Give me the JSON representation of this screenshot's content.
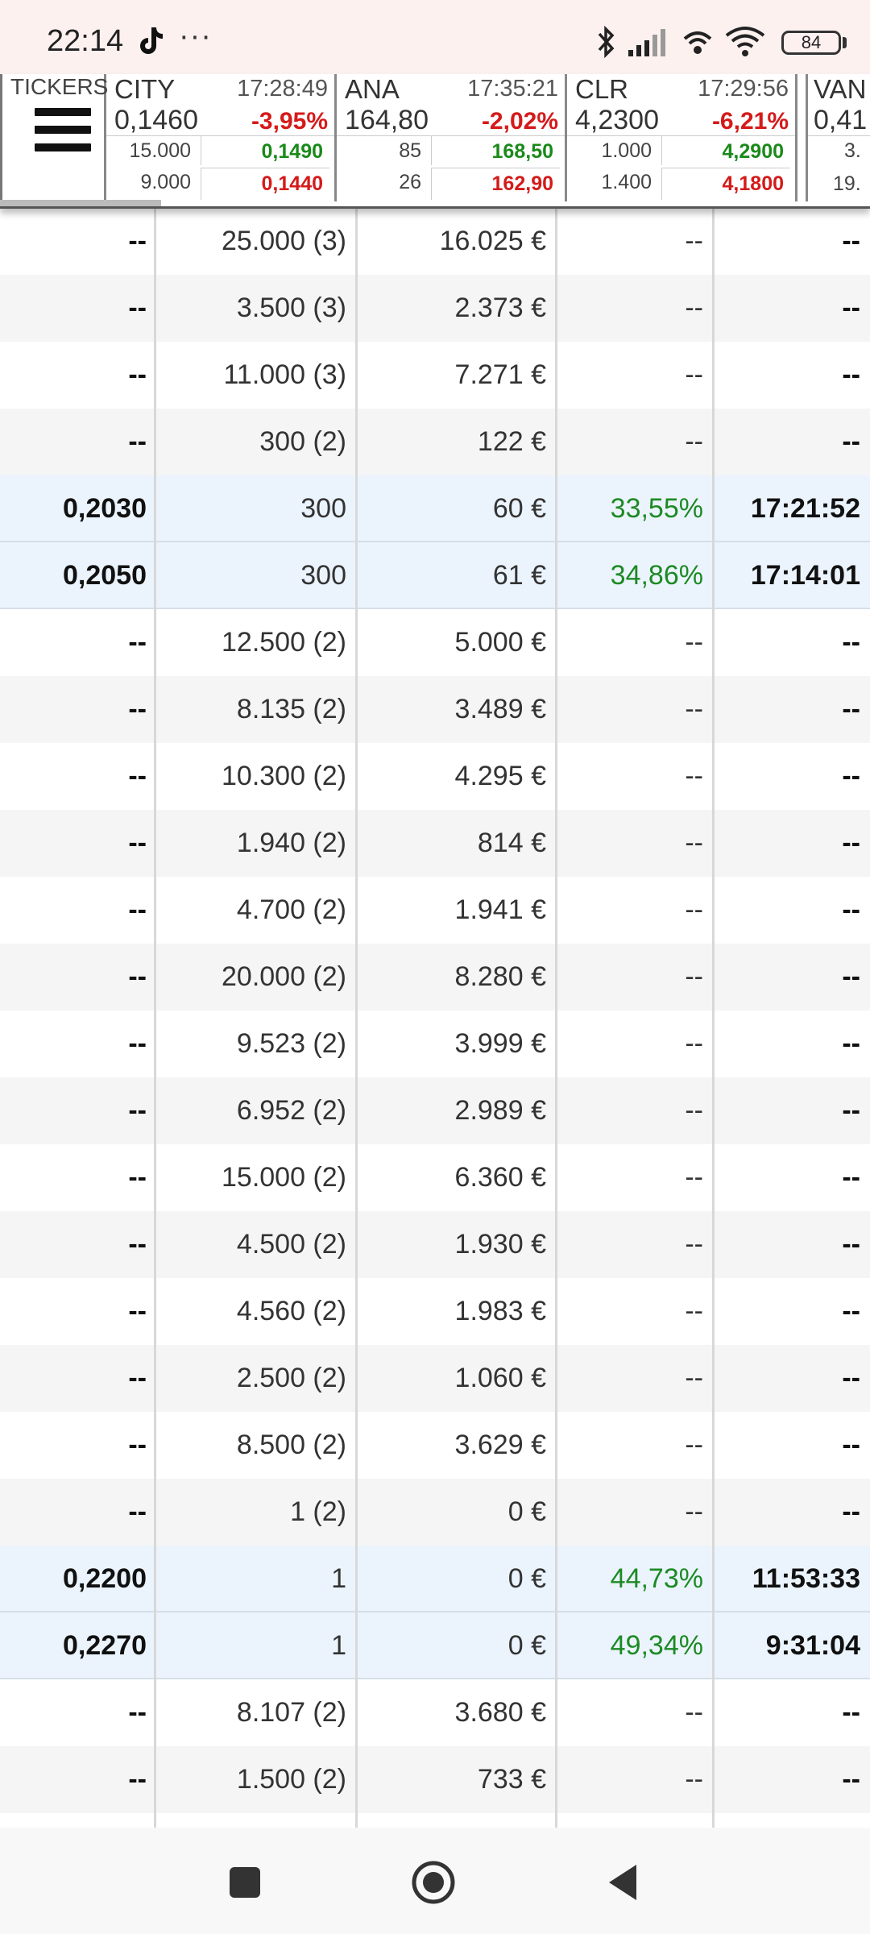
{
  "status_bar": {
    "time": "22:14",
    "more": "···",
    "battery": "84"
  },
  "ticker_bar": {
    "menu_label": "TICKERS",
    "tickers": [
      {
        "symbol": "CITY",
        "time": "17:28:49",
        "price": "0,1460",
        "change": "-3,95%",
        "bid_size": "15.000",
        "bid": "0,1490",
        "ask_size": "9.000",
        "ask": "0,1440"
      },
      {
        "symbol": "ANA",
        "time": "17:35:21",
        "price": "164,80",
        "change": "-2,02%",
        "bid_size": "85",
        "bid": "168,50",
        "ask_size": "26",
        "ask": "162,90"
      },
      {
        "symbol": "CLR",
        "time": "17:29:56",
        "price": "4,2300",
        "change": "-6,21%",
        "bid_size": "1.000",
        "bid": "4,2900",
        "ask_size": "1.400",
        "ask": "4,1800"
      },
      {
        "symbol": "VAN",
        "time": "",
        "price": "0,41",
        "change": "",
        "bid_size": "3.",
        "bid": "",
        "ask_size": "19.",
        "ask": ""
      }
    ]
  },
  "table": {
    "rows": [
      {
        "price": "--",
        "volume": "25.000 (3)",
        "amount": "16.025 €",
        "pct": "--",
        "time": "--"
      },
      {
        "price": "--",
        "volume": "3.500 (3)",
        "amount": "2.373 €",
        "pct": "--",
        "time": "--"
      },
      {
        "price": "--",
        "volume": "11.000 (3)",
        "amount": "7.271 €",
        "pct": "--",
        "time": "--"
      },
      {
        "price": "--",
        "volume": "300 (2)",
        "amount": "122 €",
        "pct": "--",
        "time": "--"
      },
      {
        "price": "0,2030",
        "volume": "300",
        "amount": "60 €",
        "pct": "33,55%",
        "time": "17:21:52"
      },
      {
        "price": "0,2050",
        "volume": "300",
        "amount": "61 €",
        "pct": "34,86%",
        "time": "17:14:01"
      },
      {
        "price": "--",
        "volume": "12.500 (2)",
        "amount": "5.000 €",
        "pct": "--",
        "time": "--"
      },
      {
        "price": "--",
        "volume": "8.135 (2)",
        "amount": "3.489 €",
        "pct": "--",
        "time": "--"
      },
      {
        "price": "--",
        "volume": "10.300 (2)",
        "amount": "4.295 €",
        "pct": "--",
        "time": "--"
      },
      {
        "price": "--",
        "volume": "1.940 (2)",
        "amount": "814 €",
        "pct": "--",
        "time": "--"
      },
      {
        "price": "--",
        "volume": "4.700 (2)",
        "amount": "1.941 €",
        "pct": "--",
        "time": "--"
      },
      {
        "price": "--",
        "volume": "20.000 (2)",
        "amount": "8.280 €",
        "pct": "--",
        "time": "--"
      },
      {
        "price": "--",
        "volume": "9.523 (2)",
        "amount": "3.999 €",
        "pct": "--",
        "time": "--"
      },
      {
        "price": "--",
        "volume": "6.952 (2)",
        "amount": "2.989 €",
        "pct": "--",
        "time": "--"
      },
      {
        "price": "--",
        "volume": "15.000 (2)",
        "amount": "6.360 €",
        "pct": "--",
        "time": "--"
      },
      {
        "price": "--",
        "volume": "4.500 (2)",
        "amount": "1.930 €",
        "pct": "--",
        "time": "--"
      },
      {
        "price": "--",
        "volume": "4.560 (2)",
        "amount": "1.983 €",
        "pct": "--",
        "time": "--"
      },
      {
        "price": "--",
        "volume": "2.500 (2)",
        "amount": "1.060 €",
        "pct": "--",
        "time": "--"
      },
      {
        "price": "--",
        "volume": "8.500 (2)",
        "amount": "3.629 €",
        "pct": "--",
        "time": "--"
      },
      {
        "price": "--",
        "volume": "1 (2)",
        "amount": "0 €",
        "pct": "--",
        "time": "--"
      },
      {
        "price": "0,2200",
        "volume": "1",
        "amount": "0 €",
        "pct": "44,73%",
        "time": "11:53:33"
      },
      {
        "price": "0,2270",
        "volume": "1",
        "amount": "0 €",
        "pct": "49,34%",
        "time": "9:31:04"
      },
      {
        "price": "--",
        "volume": "8.107 (2)",
        "amount": "3.680 €",
        "pct": "--",
        "time": "--"
      },
      {
        "price": "--",
        "volume": "1.500 (2)",
        "amount": "733 €",
        "pct": "--",
        "time": "--"
      }
    ]
  },
  "colors": {
    "up": "#1a8a1a",
    "down": "#d51a1a",
    "highlight_row": "#ebf4fd",
    "alt_row": "#f5f5f5"
  }
}
